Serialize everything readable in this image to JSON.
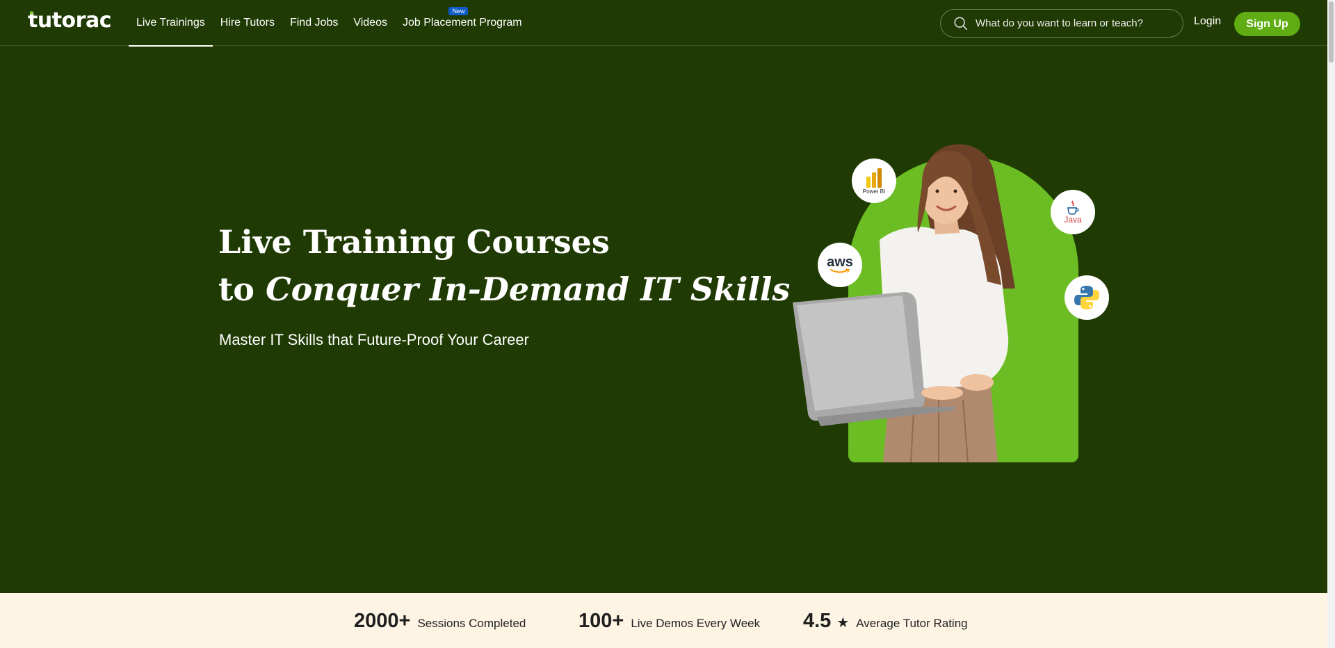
{
  "brand": {
    "name": "tutorac"
  },
  "nav": {
    "items": [
      {
        "label": "Live Trainings"
      },
      {
        "label": "Hire Tutors"
      },
      {
        "label": "Find Jobs"
      },
      {
        "label": "Videos"
      },
      {
        "label": "Job Placement Program",
        "badge": "New"
      }
    ]
  },
  "search": {
    "placeholder": "What do you want to learn or teach?"
  },
  "auth": {
    "login_label": "Login",
    "signup_label": "Sign Up"
  },
  "hero": {
    "title_line1": "Live Training Courses",
    "title_line2_prefix": "to ",
    "title_line2_emphasis": "Conquer In-Demand IT Skills",
    "subtitle": "Master IT Skills that Future-Proof Your Career",
    "tech_icons": [
      {
        "name": "powerbi-icon",
        "label": "Power BI"
      },
      {
        "name": "java-icon",
        "label": "Java"
      },
      {
        "name": "aws-icon",
        "label": "aws"
      },
      {
        "name": "python-icon",
        "label": ""
      }
    ]
  },
  "stats": [
    {
      "value": "2000+",
      "label": "Sessions Completed"
    },
    {
      "value": "100+",
      "label": "Live Demos Every Week"
    },
    {
      "value": "4.5",
      "icon": "star-icon",
      "label": "Average Tutor Rating"
    }
  ],
  "colors": {
    "background": "#1f3a03",
    "accent_green": "#5fad13",
    "arch_green": "#6bbd23",
    "stats_bg": "#fdf4e4",
    "new_badge": "#0d5cc7"
  }
}
